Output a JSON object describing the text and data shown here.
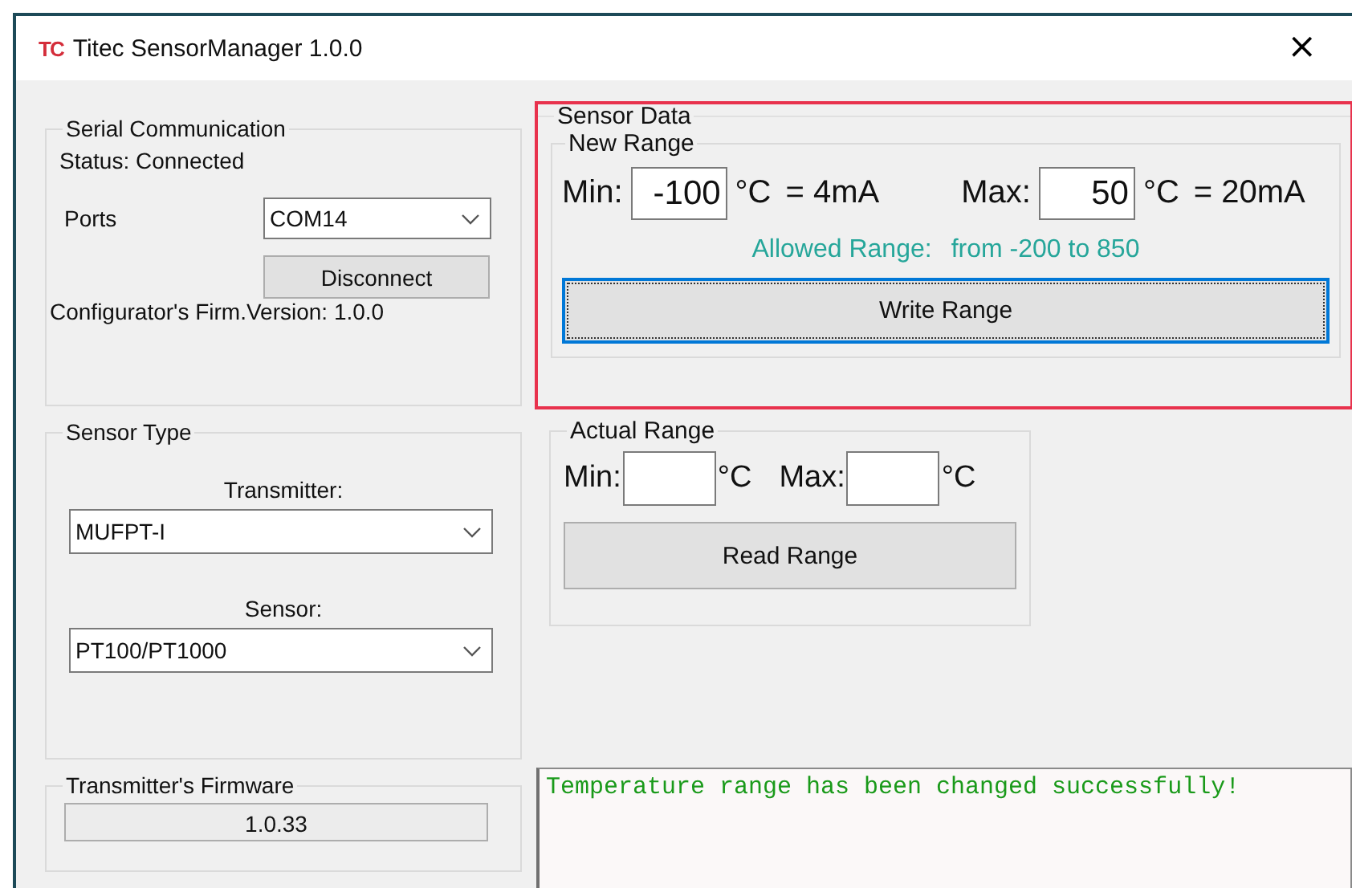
{
  "window": {
    "logo": "TC",
    "title": "Titec SensorManager 1.0.0",
    "close": "×"
  },
  "serial": {
    "title": "Serial Communication",
    "status": "Status: Connected",
    "ports_label": "Ports",
    "port": "COM14",
    "button": "Disconnect",
    "firmware": "Configurator's Firm.Version: 1.0.0"
  },
  "sensor_type": {
    "title": "Sensor Type",
    "transmitter_label": "Transmitter:",
    "transmitter": "MUFPT-I",
    "sensor_label": "Sensor:",
    "sensor": "PT100/PT1000"
  },
  "transmitter_firmware": {
    "title": "Transmitter's Firmware",
    "value": "1.0.33"
  },
  "sensor_data": {
    "title": "Sensor Data",
    "highlighted": true,
    "new_range": {
      "title": "New Range",
      "min_label": "Min:",
      "min": "-100",
      "min_unit": "°C",
      "min_current": "= 4mA",
      "max_label": "Max:",
      "max": "50",
      "max_unit": "°C",
      "max_current": "= 20mA",
      "allowed_label": "Allowed Range:",
      "allowed_value": "from -200 to 850",
      "button": "Write Range",
      "button_focused": true
    }
  },
  "actual_range": {
    "title": "Actual Range",
    "min_label": "Min:",
    "min_unit": "°C",
    "max_label": "Max:",
    "max_unit": "°C",
    "button": "Read Range"
  },
  "log": {
    "message": "Temperature range has been changed successfully!"
  }
}
